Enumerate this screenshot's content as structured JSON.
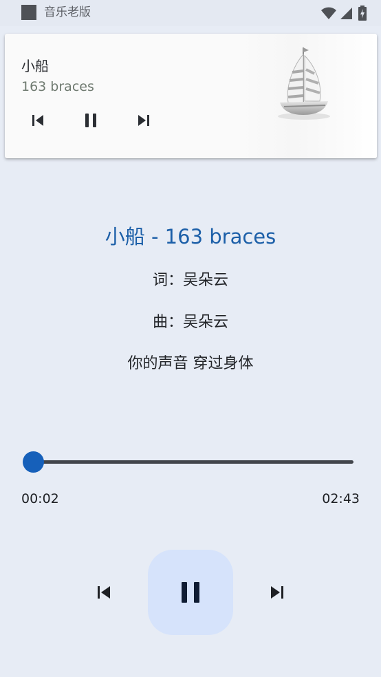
{
  "status_bar": {
    "app_name": "音乐老版",
    "icons": [
      "wifi-icon",
      "signal-icon",
      "battery-icon"
    ]
  },
  "notification": {
    "title": "小船",
    "artist": "163 braces",
    "controls": [
      "skip-previous-icon",
      "pause-icon",
      "skip-next-icon"
    ],
    "art": "sailboat-album-art"
  },
  "player": {
    "heading": "小船 - 163 braces",
    "lyrics": [
      "词：吴朵云",
      "曲：吴朵云",
      "你的声音 穿过身体"
    ],
    "progress": {
      "current": "00:02",
      "total": "02:43",
      "fraction": 0.012
    },
    "controls": [
      "skip-previous-icon",
      "pause-icon",
      "skip-next-icon"
    ]
  },
  "colors": {
    "background": "#e7ecf5",
    "accent": "#1660ba",
    "heading": "#1c5fa8",
    "pause_button_bg": "#d6e3fb"
  }
}
